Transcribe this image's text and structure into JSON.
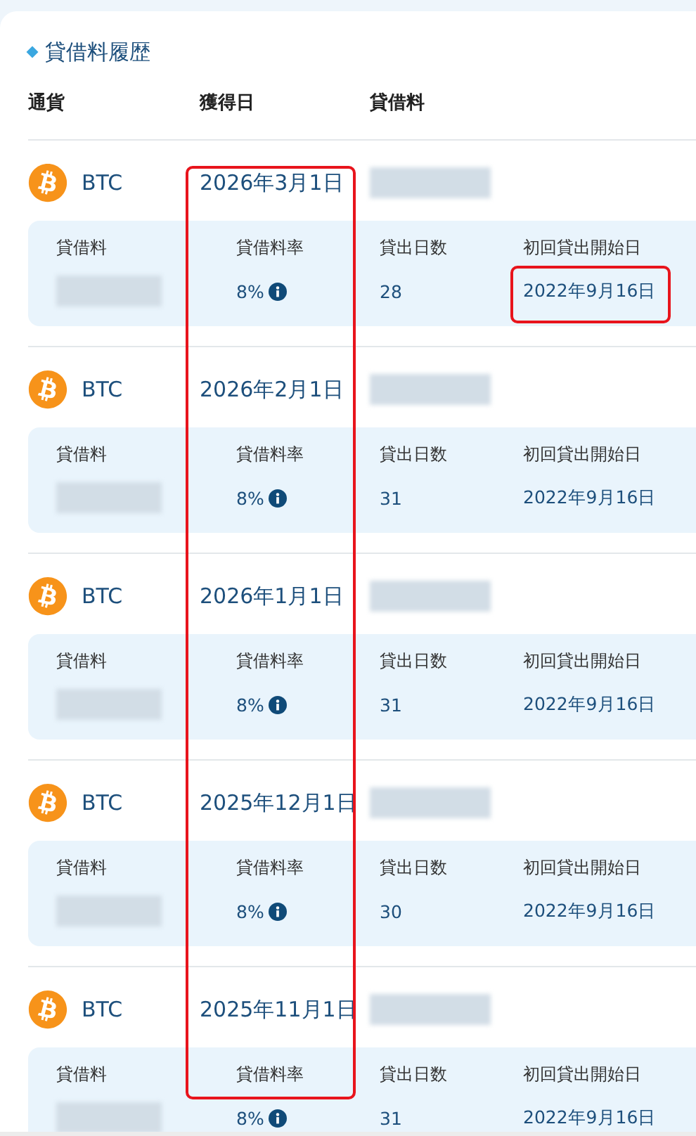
{
  "section_title": "貸借料履歴",
  "columns": [
    "通貨",
    "獲得日",
    "貸借料"
  ],
  "date_column_marked": true,
  "rows": [
    {
      "currency": "BTC",
      "date": "2026年3月1日",
      "fee_redacted": true,
      "details": {
        "labels": [
          "貸借料",
          "貸借料率",
          "貸出日数",
          "初回貸出開始日"
        ],
        "fee_redacted": true,
        "rate": "8%",
        "days": "28",
        "start_date": "2022年9月16日",
        "start_date_marked": true
      }
    },
    {
      "currency": "BTC",
      "date": "2026年2月1日",
      "fee_redacted": true,
      "details": {
        "labels": [
          "貸借料",
          "貸借料率",
          "貸出日数",
          "初回貸出開始日"
        ],
        "fee_redacted": true,
        "rate": "8%",
        "days": "31",
        "start_date": "2022年9月16日",
        "start_date_marked": false
      }
    },
    {
      "currency": "BTC",
      "date": "2026年1月1日",
      "fee_redacted": true,
      "details": {
        "labels": [
          "貸借料",
          "貸借料率",
          "貸出日数",
          "初回貸出開始日"
        ],
        "fee_redacted": true,
        "rate": "8%",
        "days": "31",
        "start_date": "2022年9月16日",
        "start_date_marked": false
      }
    },
    {
      "currency": "BTC",
      "date": "2025年12月1日",
      "fee_redacted": true,
      "details": {
        "labels": [
          "貸借料",
          "貸借料率",
          "貸出日数",
          "初回貸出開始日"
        ],
        "fee_redacted": true,
        "rate": "8%",
        "days": "30",
        "start_date": "2022年9月16日",
        "start_date_marked": false
      }
    },
    {
      "currency": "BTC",
      "date": "2025年11月1日",
      "fee_redacted": true,
      "details": {
        "labels": [
          "貸借料",
          "貸借料率",
          "貸出日数",
          "初回貸出開始日"
        ],
        "fee_redacted": true,
        "rate": "8%",
        "days": "31",
        "start_date": "2022年9月16日",
        "start_date_marked": false
      }
    }
  ]
}
